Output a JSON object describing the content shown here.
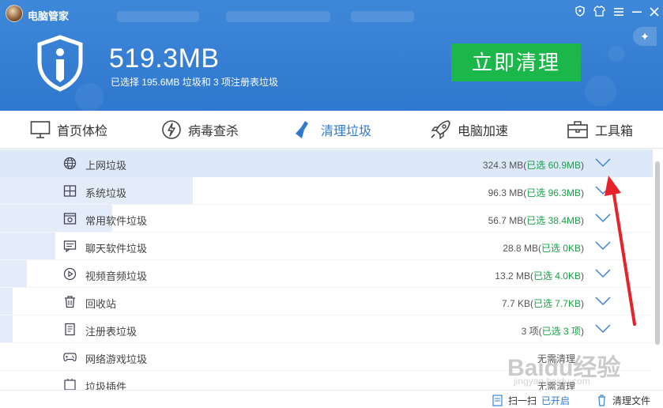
{
  "app": {
    "title": "电脑管家"
  },
  "summary": {
    "total_size": "519.3MB",
    "detail": "已选择 195.6MB 垃圾和 3 项注册表垃圾",
    "clean_button": "立即清理"
  },
  "nav": [
    {
      "label": "首页体检",
      "icon": "monitor-icon"
    },
    {
      "label": "病毒查杀",
      "icon": "lightning-shield-icon"
    },
    {
      "label": "清理垃圾",
      "icon": "broom-icon",
      "active": true
    },
    {
      "label": "电脑加速",
      "icon": "rocket-icon"
    },
    {
      "label": "工具箱",
      "icon": "toolbox-icon"
    }
  ],
  "rows": [
    {
      "name": "上网垃圾",
      "icon": "globe-icon",
      "size": "324.3 MB",
      "selected": "已选 60.9MB",
      "highlight": true,
      "progress": 0
    },
    {
      "name": "系统垃圾",
      "icon": "windows-icon",
      "size": "96.3 MB",
      "selected": "已选 96.3MB",
      "progress": 0.3
    },
    {
      "name": "常用软件垃圾",
      "icon": "software-icon",
      "size": "56.7 MB",
      "selected": "已选 38.4MB",
      "progress": 0.17
    },
    {
      "name": "聊天软件垃圾",
      "icon": "chat-icon",
      "size": "28.8 MB",
      "selected": "已选 0KB",
      "progress": 0.085
    },
    {
      "name": "视频音频垃圾",
      "icon": "play-icon",
      "size": "13.2 MB",
      "selected": "已选 4.0KB",
      "progress": 0.04
    },
    {
      "name": "回收站",
      "icon": "trash-icon",
      "size": "7.7 KB",
      "selected": "已选 7.7KB",
      "progress": 0.02
    },
    {
      "name": "注册表垃圾",
      "icon": "registry-icon",
      "size": "3 项",
      "selected": "已选 3 项",
      "progress": 0.02
    },
    {
      "name": "网络游戏垃圾",
      "icon": "gamepad-icon",
      "size": "无需清理",
      "selected": "",
      "progress": 0
    },
    {
      "name": "垃圾插件",
      "icon": "plugin-icon",
      "size": "无需清理",
      "selected": "",
      "progress": 0
    }
  ],
  "footer": {
    "scan_label": "扫一扫",
    "scan_state": "已开启",
    "clean_files": "清理文件"
  },
  "watermark": {
    "main": "Baidu经验",
    "sub": "jingyan.baidu.com"
  },
  "colors": {
    "header_blue": "#3a82d6",
    "green": "#1cb74a",
    "selected_text": "#1aa048",
    "annotation_arrow": "#e8222a"
  }
}
